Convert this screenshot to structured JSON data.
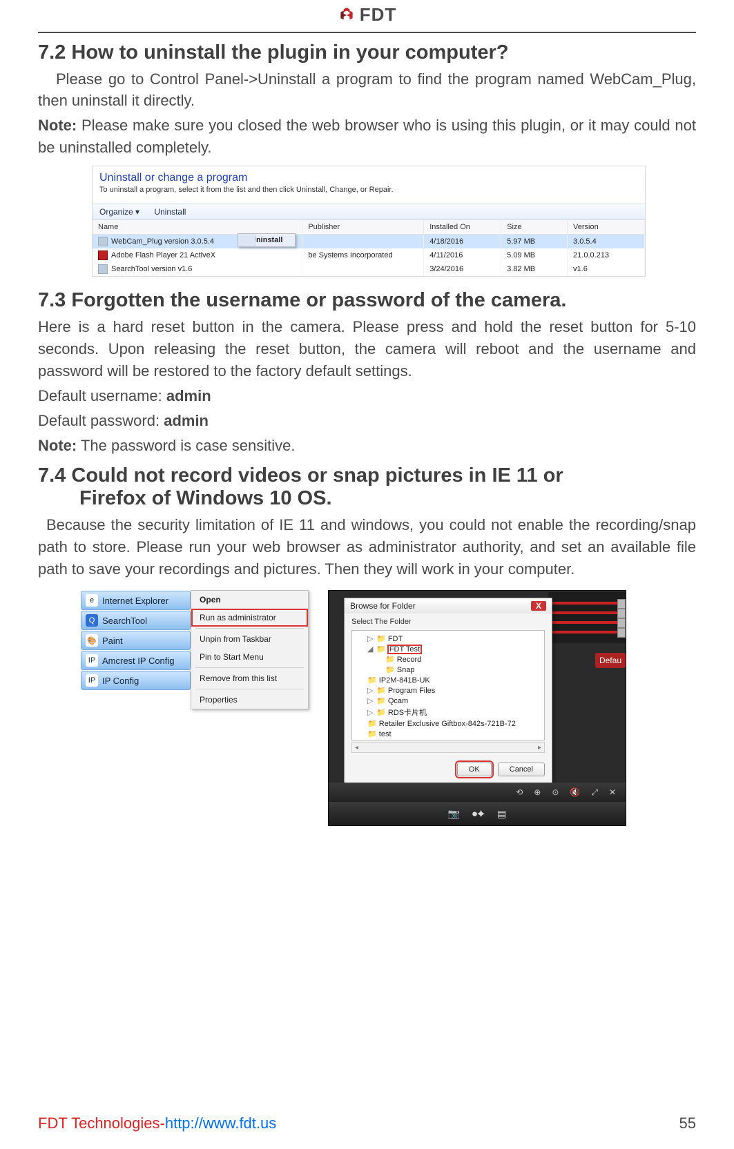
{
  "brand": "FDT",
  "sections": {
    "s72": {
      "title": "7.2 How to uninstall the plugin in your computer?",
      "p1": "Please go to Control Panel->Uninstall a program to find the program named WebCam_Plug, then uninstall it directly.",
      "noteLabel": "Note:",
      "note": " Please make sure you closed the web browser who is using this plugin, or it may could not be uninstalled completely."
    },
    "s73": {
      "title": "7.3 Forgotten the username or password of the camera.",
      "p1": "Here is a hard reset button in the camera. Please press and hold the reset button for 5-10 seconds. Upon releasing the reset button, the camera will reboot and the username and password will be restored to the factory default settings.",
      "defUserLabel": "Default username: ",
      "defUser": "admin",
      "defPassLabel": "Default password: ",
      "defPass": "admin",
      "noteLabel": "Note:",
      "note": " The password is case sensitive."
    },
    "s74": {
      "title1": "7.4 Could not record videos or snap pictures in IE 11 or",
      "title2": "Firefox of Windows 10 OS.",
      "p1": "Because the security limitation of IE 11 and windows, you could not enable the recording/snap path to store. Please run your web browser as administrator authority, and set an available file path to save your recordings and pictures. Then they will work in your computer."
    }
  },
  "cp": {
    "heading": "Uninstall or change a program",
    "sub": "To uninstall a program, select it from the list and then click Uninstall, Change, or Repair.",
    "toolbar": {
      "organize": "Organize ▾",
      "uninstall": "Uninstall"
    },
    "cols": {
      "name": "Name",
      "publisher": "Publisher",
      "installed": "Installed On",
      "size": "Size",
      "version": "Version"
    },
    "rows": [
      {
        "name": "WebCam_Plug version 3.0.5.4",
        "publisher": "",
        "installed": "4/18/2016",
        "size": "5.97 MB",
        "version": "3.0.5.4"
      },
      {
        "name": "Adobe Flash Player 21 ActiveX",
        "publisher": "be Systems Incorporated",
        "installed": "4/11/2016",
        "size": "5.09 MB",
        "version": "21.0.0.213"
      },
      {
        "name": "SearchTool version v1.6",
        "publisher": "",
        "installed": "3/24/2016",
        "size": "3.82 MB",
        "version": "v1.6"
      }
    ],
    "ctxUninstall": "Uninstall"
  },
  "taskbar": {
    "items": [
      "Internet Explorer",
      "SearchTool",
      "Paint",
      "Amcrest IP Config",
      "IP Config"
    ]
  },
  "ctx": {
    "open": "Open",
    "raa": "Run as administrator",
    "unpin": "Unpin from Taskbar",
    "pin": "Pin to Start Menu",
    "remove": "Remove from this list",
    "props": "Properties"
  },
  "browse": {
    "title": "Browse for Folder",
    "select": "Select The Folder",
    "nodes": [
      "FDT",
      "FDT Test",
      "Record",
      "Snap",
      "IP2M-841B-UK",
      "Program Files",
      "Qcam",
      "RDS卡片机",
      "Retailer Exclusive Giftbox-842s-721B-72",
      "test"
    ],
    "ok": "OK",
    "cancel": "Cancel"
  },
  "cam": {
    "default": "Defau"
  },
  "footer": {
    "company": "FDT Technologies-",
    "url": "http://www.fdt.us",
    "page": "55"
  }
}
